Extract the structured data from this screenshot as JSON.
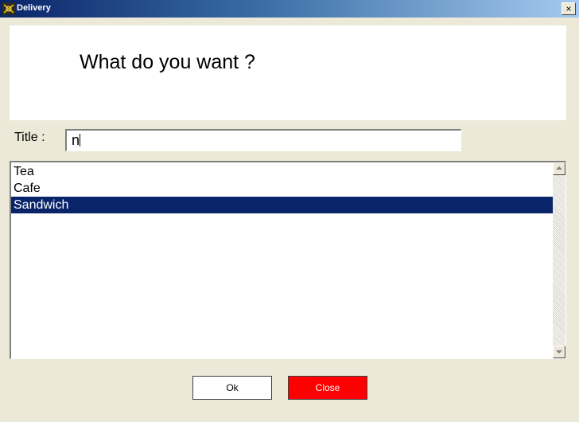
{
  "window": {
    "title": "Delivery",
    "close_glyph": "×"
  },
  "banner": {
    "text": "What do you want ?"
  },
  "form": {
    "title_label": "Title :",
    "title_value": "n"
  },
  "list": {
    "items": [
      {
        "label": "Tea",
        "selected": false
      },
      {
        "label": "Cafe",
        "selected": false
      },
      {
        "label": "Sandwich",
        "selected": true
      }
    ]
  },
  "buttons": {
    "ok_label": "Ok",
    "close_label": "Close"
  },
  "colors": {
    "selection": "#0a246a",
    "close_button": "#ff0000",
    "window_bg": "#ece9d8"
  },
  "icons": {
    "app_icon": "delivery-app-icon",
    "close": "close-icon"
  }
}
